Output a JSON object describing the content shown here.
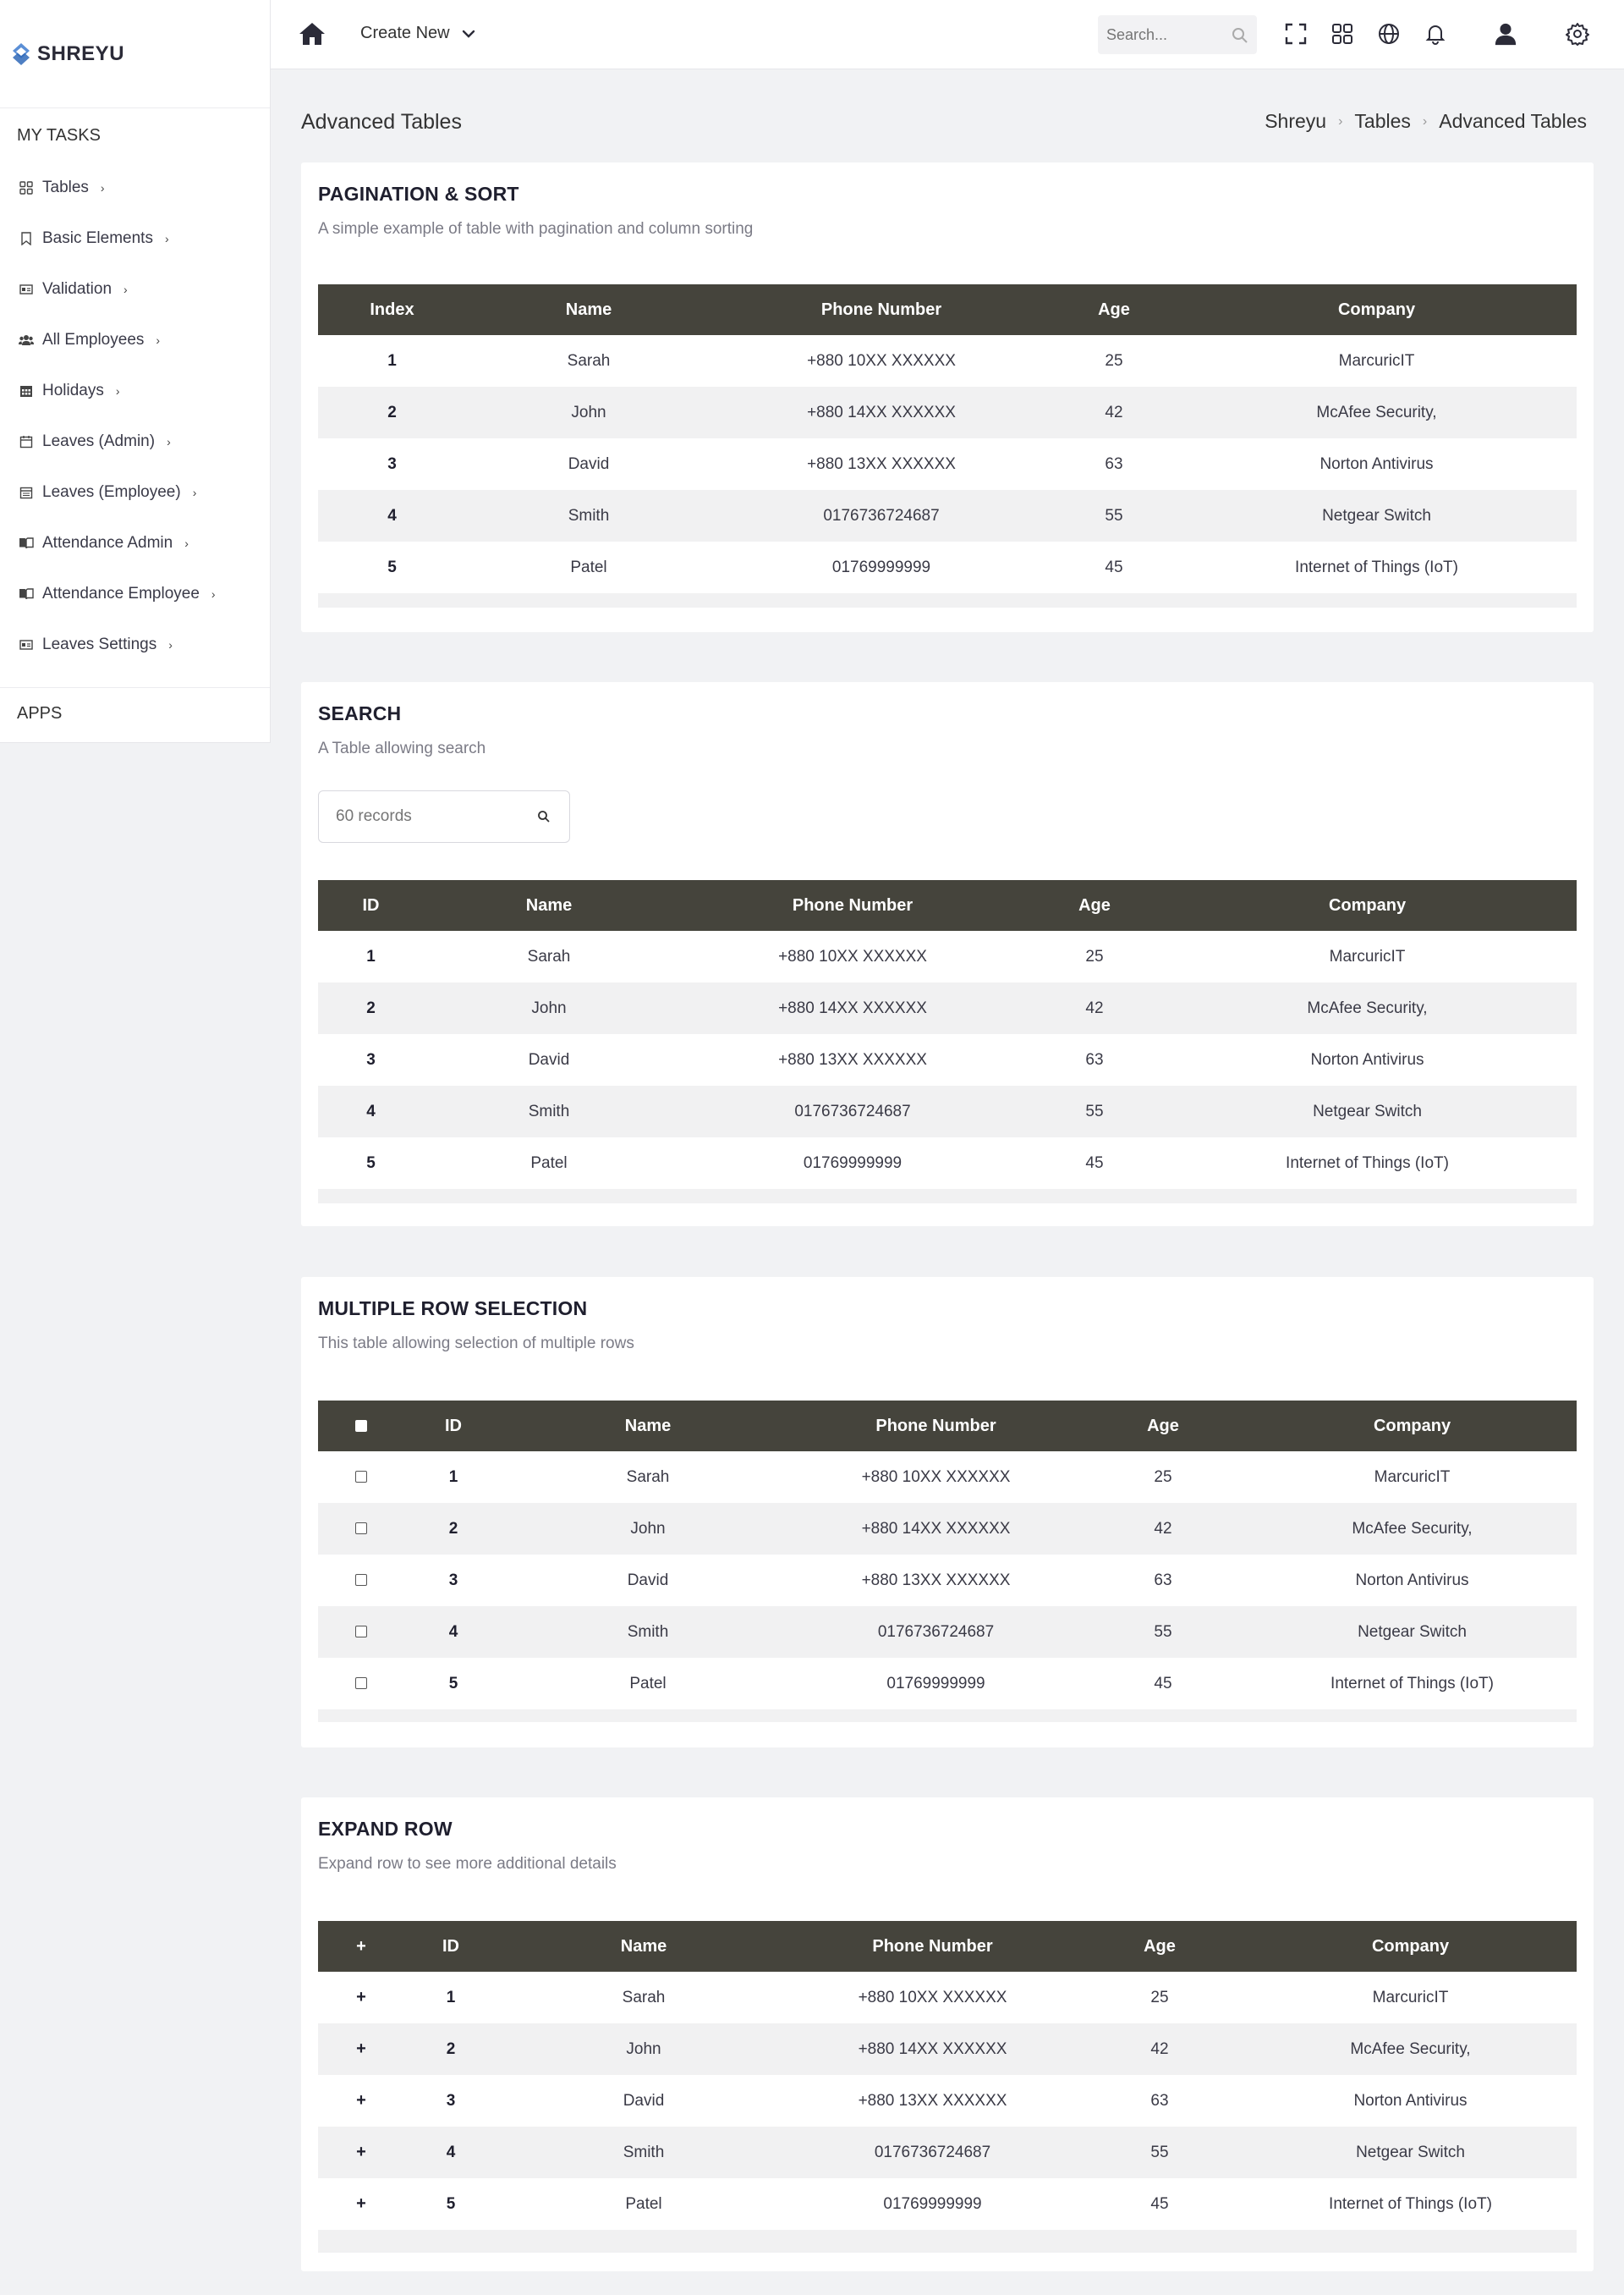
{
  "brand": {
    "name": "SHREYU"
  },
  "sidebar": {
    "section_tasks": "MY TASKS",
    "section_apps": "APPS",
    "items": [
      {
        "label": "Tables",
        "icon": "grid-icon"
      },
      {
        "label": "Basic Elements",
        "icon": "bookmark-icon"
      },
      {
        "label": "Validation",
        "icon": "id-card-icon"
      },
      {
        "label": "All Employees",
        "icon": "users-icon"
      },
      {
        "label": "Holidays",
        "icon": "calendar-grid-icon"
      },
      {
        "label": "Leaves (Admin)",
        "icon": "calendar-icon"
      },
      {
        "label": "Leaves (Employee)",
        "icon": "calendar-check-icon"
      },
      {
        "label": "Attendance Admin",
        "icon": "book-open-icon"
      },
      {
        "label": "Attendance Employee",
        "icon": "book-open-icon"
      },
      {
        "label": "Leaves Settings",
        "icon": "id-card-icon"
      }
    ]
  },
  "topbar": {
    "create_new": "Create New",
    "search_placeholder": "Search..."
  },
  "page": {
    "title": "Advanced Tables",
    "breadcrumb": [
      "Shreyu",
      "Tables",
      "Advanced Tables"
    ]
  },
  "cards": {
    "pagination": {
      "title": "PAGINATION & SORT",
      "subtitle": "A simple example of table with pagination and column sorting",
      "columns": [
        "Index",
        "Name",
        "Phone Number",
        "Age",
        "Company"
      ]
    },
    "search": {
      "title": "SEARCH",
      "subtitle": "A Table allowing search",
      "placeholder": "60 records",
      "columns": [
        "ID",
        "Name",
        "Phone Number",
        "Age",
        "Company"
      ]
    },
    "multi": {
      "title": "MULTIPLE ROW SELECTION",
      "subtitle": "This table allowing selection of multiple rows",
      "columns": [
        "ID",
        "Name",
        "Phone Number",
        "Age",
        "Company"
      ]
    },
    "expand": {
      "title": "EXPAND ROW",
      "subtitle": "Expand row to see more additional details",
      "expand_symbol": "+",
      "columns": [
        "ID",
        "Name",
        "Phone Number",
        "Age",
        "Company"
      ]
    }
  },
  "rows": [
    {
      "id": "1",
      "name": "Sarah",
      "phone": "+880 10XX XXXXXX",
      "age": "25",
      "company": "MarcuricIT"
    },
    {
      "id": "2",
      "name": "John",
      "phone": "+880 14XX XXXXXX",
      "age": "42",
      "company": "McAfee Security,"
    },
    {
      "id": "3",
      "name": "David",
      "phone": "+880 13XX XXXXXX",
      "age": "63",
      "company": "Norton Antivirus"
    },
    {
      "id": "4",
      "name": "Smith",
      "phone": "0176736724687",
      "age": "55",
      "company": "Netgear Switch"
    },
    {
      "id": "5",
      "name": "Patel",
      "phone": "01769999999",
      "age": "45",
      "company": "Internet of Things (IoT)"
    }
  ]
}
